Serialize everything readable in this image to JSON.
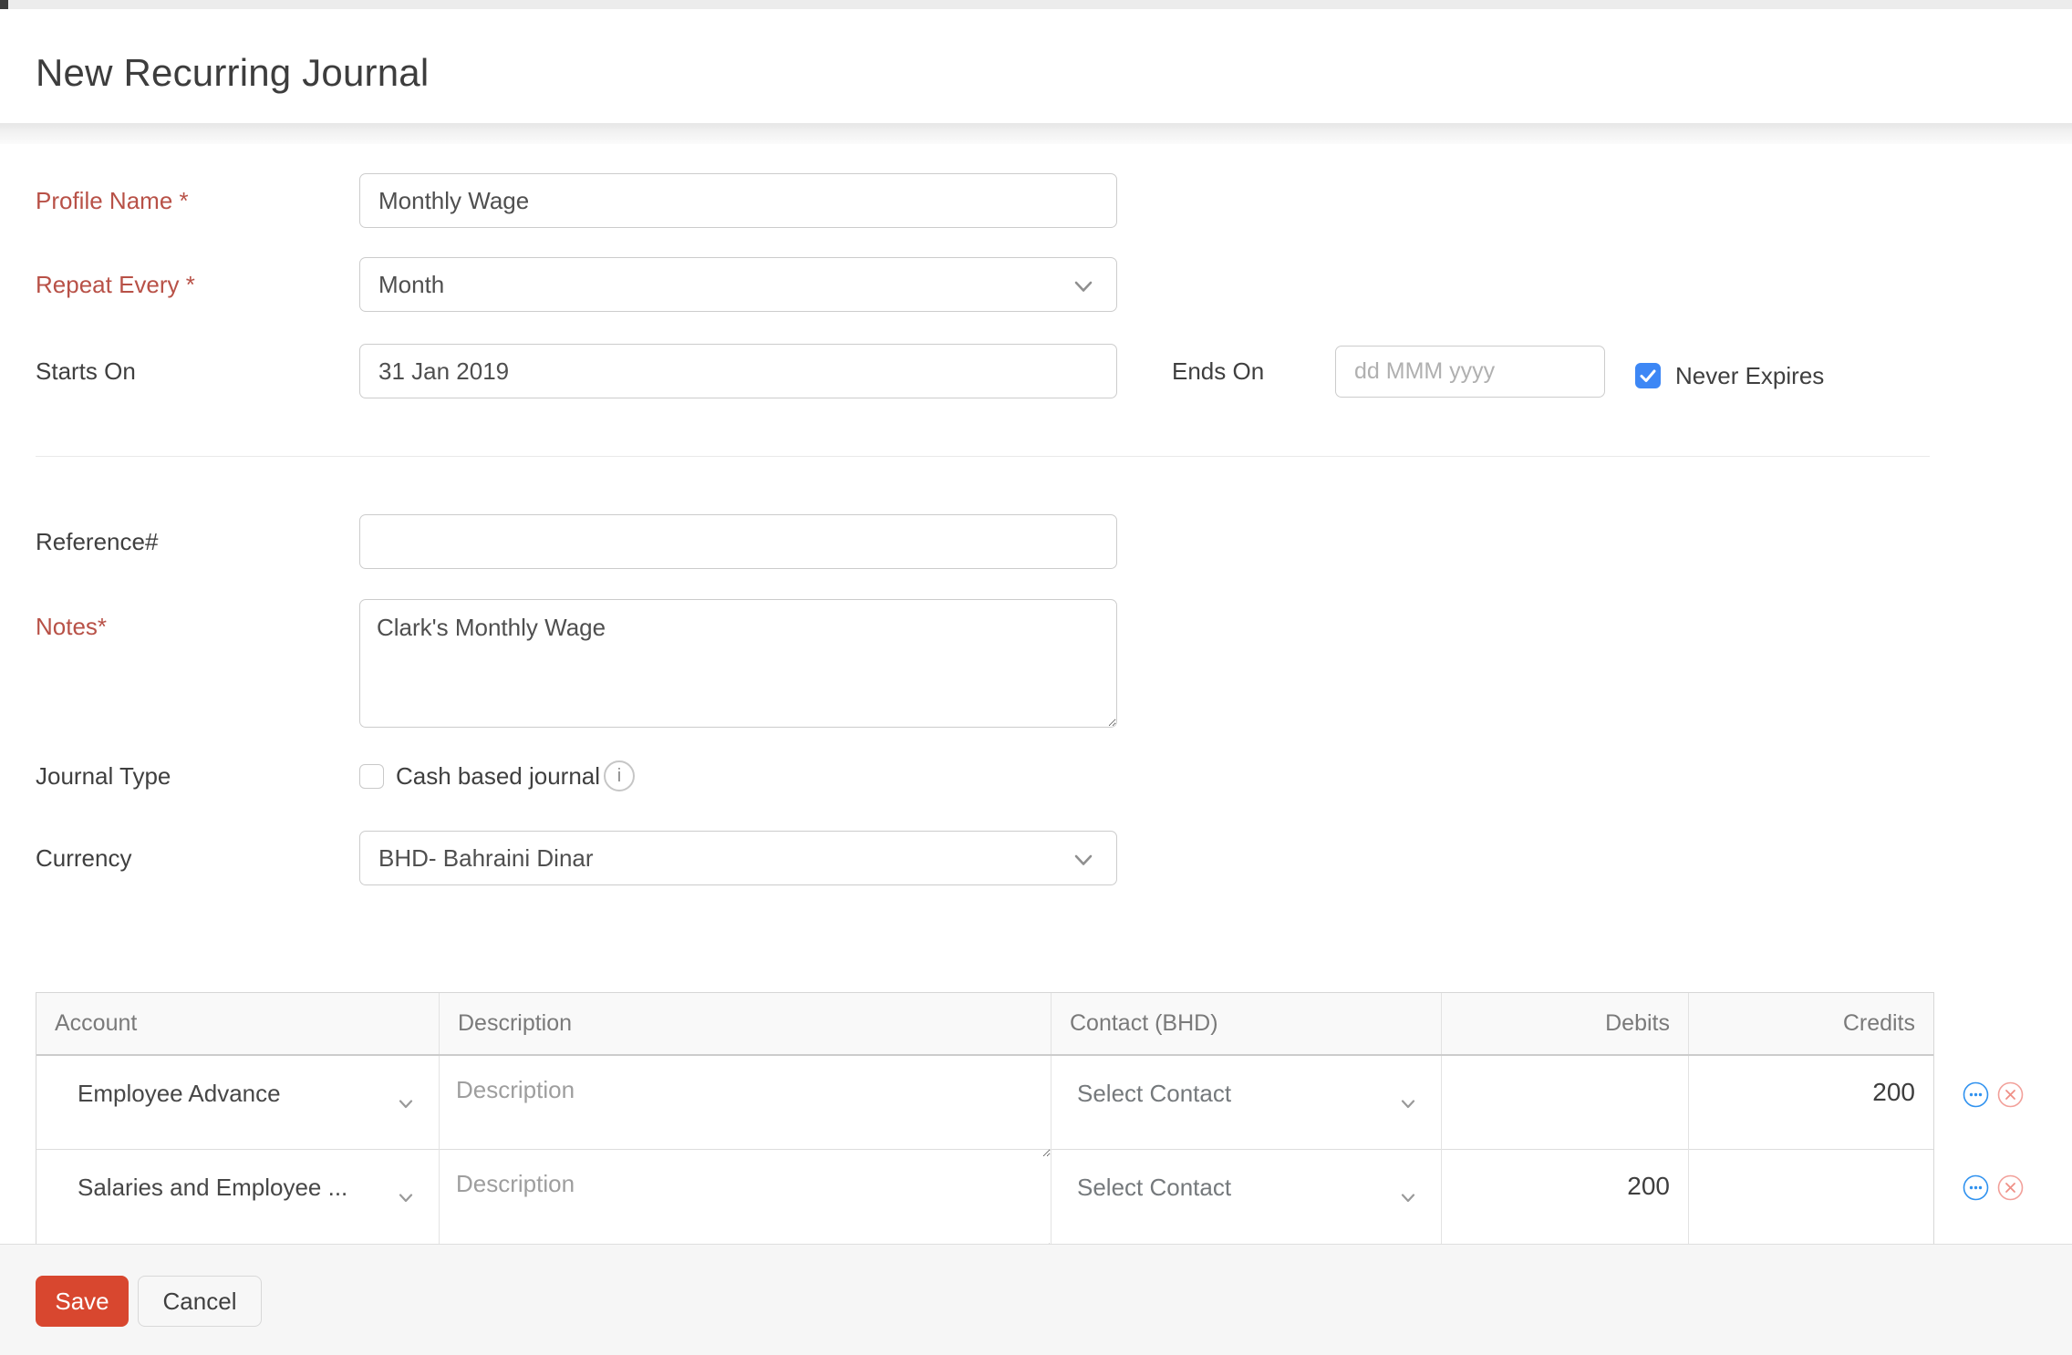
{
  "header": {
    "title": "New Recurring Journal"
  },
  "form": {
    "profile_name": {
      "label": "Profile Name *",
      "value": "Monthly Wage"
    },
    "repeat_every": {
      "label": "Repeat Every *",
      "value": "Month"
    },
    "starts_on": {
      "label": "Starts On",
      "value": "31 Jan 2019"
    },
    "ends_on": {
      "label": "Ends On",
      "placeholder": "dd MMM yyyy"
    },
    "never_expires": {
      "label": "Never Expires",
      "checked": true
    },
    "reference": {
      "label": "Reference#",
      "value": ""
    },
    "notes": {
      "label": "Notes*",
      "value": "Clark's Monthly Wage"
    },
    "journal_type": {
      "label": "Journal Type",
      "checkbox_label": "Cash based journal",
      "checked": false
    },
    "currency": {
      "label": "Currency",
      "value": "BHD- Bahraini Dinar"
    }
  },
  "table": {
    "columns": {
      "account": "Account",
      "description": "Description",
      "contact": "Contact (BHD)",
      "debits": "Debits",
      "credits": "Credits"
    },
    "rows": [
      {
        "account": "Employee Advance",
        "description_placeholder": "Description",
        "contact": "Select Contact",
        "debits": "",
        "credits": "200"
      },
      {
        "account": "Salaries and Employee ...",
        "description_placeholder": "Description",
        "contact": "Select Contact",
        "debits": "200",
        "credits": ""
      }
    ]
  },
  "footer": {
    "save_label": "Save",
    "cancel_label": "Cancel"
  },
  "colors": {
    "save_red": "#d8472f",
    "label_red": "#b85147",
    "checkbox_blue": "#3d87f5",
    "icon_blue": "#3092ef",
    "icon_pink": "#ef8f86"
  }
}
